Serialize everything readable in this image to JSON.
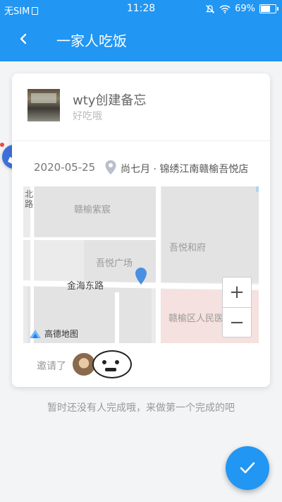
{
  "statusbar": {
    "carrier": "无SIM",
    "time": "11:28",
    "battery": "69%"
  },
  "appbar": {
    "title": "一家人吃饭"
  },
  "card": {
    "title": "wty创建备忘",
    "subtitle": "好吃哦",
    "date": "2020-05-25",
    "location": "尚七月 · 锦绣江南赣榆吾悦店",
    "invite_label": "邀请了"
  },
  "map": {
    "labels": [
      "北路",
      "赣榆紫宸",
      "吾悦和府",
      "吾悦广场",
      "金海东路",
      "赣榆区人民医院"
    ],
    "logo_text": "高德地图",
    "zoom_in": "+",
    "zoom_out": "−"
  },
  "hint": "暂时还没有人完成哦，来做第一个完成的吧",
  "colors": {
    "primary": "#2196f3",
    "pin": "#4a90e2",
    "hospital": "#f5e1df"
  }
}
